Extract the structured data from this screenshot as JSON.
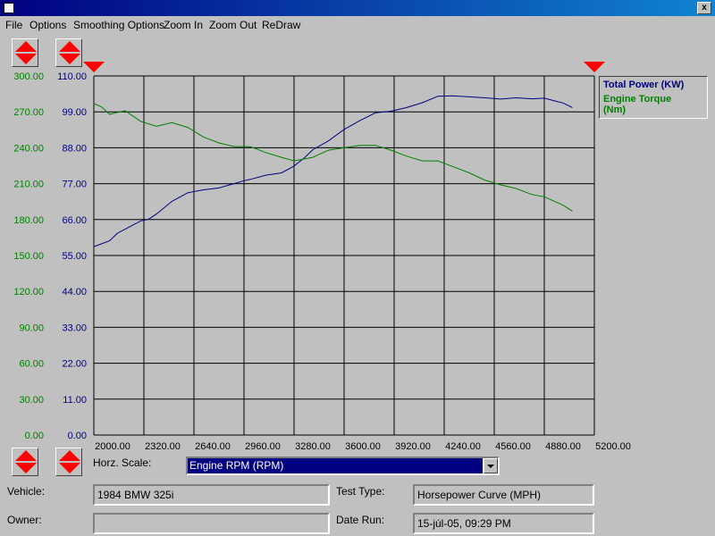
{
  "window": {
    "title": "",
    "close_glyph": "x"
  },
  "menu": [
    {
      "label": "File"
    },
    {
      "label": "Options"
    },
    {
      "label": "Smoothing Options"
    },
    {
      "label": "Zoom In"
    },
    {
      "label": "Zoom Out"
    },
    {
      "label": "ReDraw"
    }
  ],
  "colors": {
    "power": "#000080",
    "torque": "#008000",
    "marker": "#ff0000",
    "plot_bg": "#c0c0c0",
    "grid": "#000000"
  },
  "icons": {
    "scale_buttons": "up-down-arrow-icon",
    "range_markers": "triangle-down-icon"
  },
  "chart_data": {
    "type": "line",
    "xlabel": "",
    "x_ticks": [
      "2000.00",
      "2320.00",
      "2640.00",
      "2960.00",
      "3280.00",
      "3600.00",
      "3920.00",
      "4240.00",
      "4560.00",
      "4880.00",
      "5200.00"
    ],
    "xlim": [
      2000,
      5200
    ],
    "grid": true,
    "legend_position": "right",
    "series": [
      {
        "name": "Total Power (KW)",
        "axis": "right-inner",
        "ylim": [
          0,
          110
        ],
        "y_ticks": [
          "110.00",
          "99.00",
          "88.00",
          "77.00",
          "66.00",
          "55.00",
          "44.00",
          "33.00",
          "22.00",
          "11.00",
          "0.00"
        ],
        "x": [
          2000,
          2100,
          2150,
          2300,
          2350,
          2400,
          2500,
          2600,
          2700,
          2800,
          2960,
          3000,
          3100,
          3200,
          3280,
          3350,
          3400,
          3500,
          3600,
          3700,
          3800,
          3900,
          4000,
          4100,
          4200,
          4300,
          4400,
          4500,
          4600,
          4700,
          4800,
          4880,
          4950,
          5000,
          5060
        ],
        "values": [
          57.7,
          59.5,
          61.8,
          65.6,
          66.1,
          67.7,
          71.6,
          74.2,
          75.1,
          75.7,
          77.9,
          78.3,
          79.6,
          80.3,
          82.4,
          85.1,
          87.4,
          90.1,
          93.6,
          96.3,
          98.7,
          99.2,
          100.3,
          101.8,
          103.8,
          103.9,
          103.6,
          103.3,
          102.9,
          103.3,
          103.0,
          103.2,
          102.3,
          101.7,
          100.3
        ]
      },
      {
        "name": "Engine Torque (Nm)",
        "axis": "left-outer",
        "ylim": [
          0,
          300
        ],
        "y_ticks": [
          "300.00",
          "270.00",
          "240.00",
          "210.00",
          "180.00",
          "150.00",
          "120.00",
          "90.00",
          "60.00",
          "30.00",
          "0.00"
        ],
        "x": [
          2000,
          2050,
          2100,
          2200,
          2300,
          2400,
          2500,
          2600,
          2700,
          2800,
          2900,
          3000,
          3100,
          3200,
          3280,
          3400,
          3500,
          3600,
          3700,
          3800,
          3900,
          4000,
          4100,
          4200,
          4300,
          4400,
          4500,
          4600,
          4700,
          4800,
          4880,
          5000,
          5060
        ],
        "values": [
          277,
          274,
          268,
          271,
          262,
          258,
          261,
          257,
          249,
          244,
          241,
          241,
          236,
          232,
          229,
          232,
          238,
          240,
          242,
          242,
          238,
          233,
          229,
          229,
          224,
          219,
          213,
          209,
          206,
          201,
          199,
          192,
          187
        ]
      }
    ]
  },
  "legend": {
    "power": "Total Power (KW)",
    "torque_line1": "Engine Torque",
    "torque_line2": "(Nm)"
  },
  "form": {
    "horz_scale_label": "Horz. Scale:",
    "horz_scale_value": "Engine RPM (RPM)",
    "vehicle_label": "Vehicle:",
    "vehicle_value": "1984 BMW 325i",
    "owner_label": "Owner:",
    "owner_value": "",
    "test_type_label": "Test Type:",
    "test_type_value": "Horsepower Curve (MPH)",
    "date_run_label": "Date Run:",
    "date_run_value": "15-júl-05, 09:29 PM"
  }
}
